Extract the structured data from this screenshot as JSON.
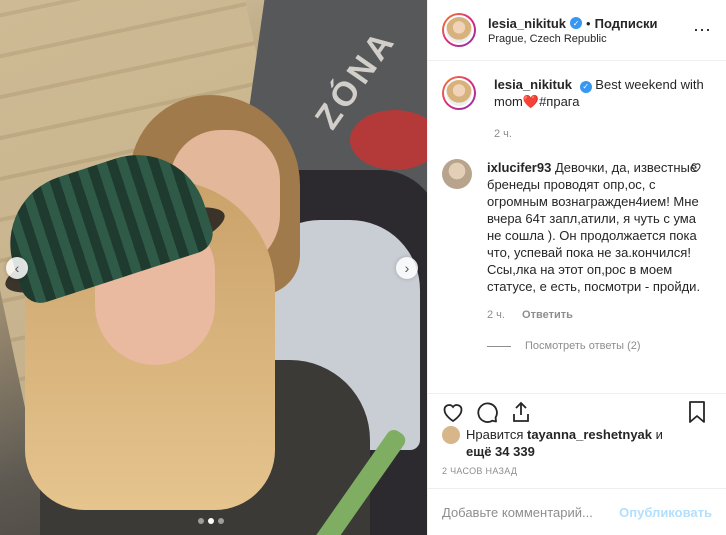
{
  "post": {
    "username": "lesia_nikituk",
    "follow_label": "Подписки",
    "separator": "•",
    "location": "Prague, Czech Republic",
    "more_icon": "more-horizontal-icon",
    "photo_slides": 3,
    "current_slide": 2
  },
  "caption": {
    "username": "lesia_nikituk",
    "text": "Best weekend with mom❤️#прага",
    "time": "2 ч."
  },
  "comments": [
    {
      "username": "ixlucifer93",
      "text": "Девочки, да, известные бренеды проводят опр,ос, с огромным вознагражден4ием! Мне вчера 64т запл,атили, я чуть с ума не сошла ). Он продолжается пока что, успевай пока не за.кончился! Ссы,лка на этот оп,рос в моем статусе, е есть, посмотри - пройди.",
      "time": "2 ч.",
      "reply_label": "Ответить",
      "view_replies": "Посмотреть ответы (2)"
    }
  ],
  "likes": {
    "prefix": "Нравится",
    "username": "tayanna_reshetnyak",
    "and": "и",
    "others": "ещё 34 339"
  },
  "timestamp": "2 ЧАСОВ НАЗАД",
  "composer": {
    "placeholder": "Добавьте комментарий...",
    "publish_label": "Опубликовать"
  }
}
